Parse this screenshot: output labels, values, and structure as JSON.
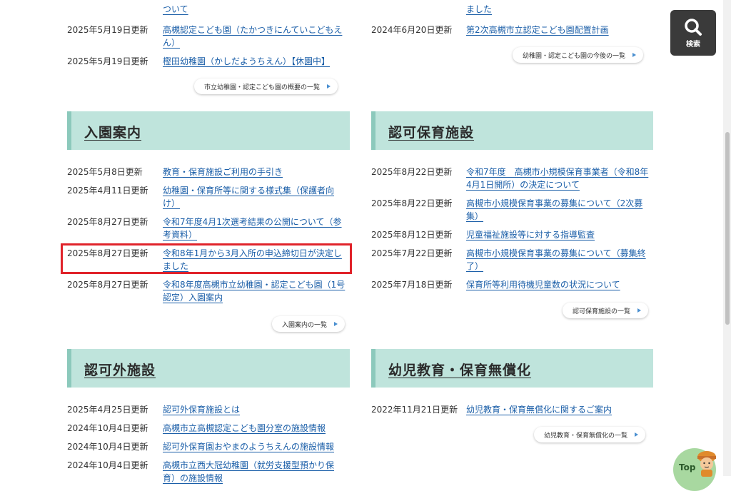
{
  "top_left": {
    "partial_row": {
      "link_tail": "ついて"
    },
    "rows": [
      {
        "date": "2025年5月19日更新",
        "link": [
          "高槻認定こども園（たかつきにんていこどもえ",
          "ん）"
        ]
      },
      {
        "date": "2025年5月19日更新",
        "link": [
          "樫田幼稚園（かしだようちえん）【休園中】"
        ]
      }
    ],
    "more": "市立幼稚園・認定こども園の概要の一覧"
  },
  "top_right": {
    "partial_row": {
      "link_tail": "ました"
    },
    "rows": [
      {
        "date": "2024年6月20日更新",
        "link": [
          "第2次高槻市立認定こども園配置計画"
        ]
      }
    ],
    "more": "幼稚園・認定こども園の今後の一覧"
  },
  "admission": {
    "title": "入園案内",
    "rows": [
      {
        "date": "2025年5月8日更新",
        "link": [
          "教育・保育施設ご利用の手引き"
        ]
      },
      {
        "date": "2025年4月11日更新",
        "link": [
          "幼稚園・保育所等に関する様式集（保護者向",
          "け）"
        ]
      },
      {
        "date": "2025年8月27日更新",
        "link": [
          "令和7年度4月1次選考結果の公開について（参",
          "考資料）"
        ]
      },
      {
        "date": "2025年8月27日更新",
        "link": [
          "令和8年1月から3月入所の申込締切日が決定し",
          "ました"
        ]
      },
      {
        "date": "2025年8月27日更新",
        "link": [
          "令和8年度高槻市立幼稚園・認定こども園（1号",
          "認定）入園案内"
        ]
      }
    ],
    "more": "入園案内の一覧"
  },
  "licensed": {
    "title": "認可保育施設",
    "rows": [
      {
        "date": "2025年8月22日更新",
        "link": [
          "令和7年度　高槻市小規模保育事業者（令和8年",
          "4月1日開所）の決定について"
        ]
      },
      {
        "date": "2025年8月22日更新",
        "link": [
          "高槻市小規模保育事業の募集について（2次募",
          "集）"
        ]
      },
      {
        "date": "2025年8月12日更新",
        "link": [
          "児童福祉施設等に対する指導監査"
        ]
      },
      {
        "date": "2025年7月22日更新",
        "link": [
          "高槻市小規模保育事業の募集について（募集終",
          "了）"
        ]
      },
      {
        "date": "2025年7月18日更新",
        "link": [
          "保育所等利用待機児童数の状況について"
        ]
      }
    ],
    "more": "認可保育施設の一覧"
  },
  "unlicensed": {
    "title": "認可外施設",
    "rows": [
      {
        "date": "2025年4月25日更新",
        "link": [
          "認可外保育施設とは"
        ]
      },
      {
        "date": "2024年10月4日更新",
        "link": [
          "高槻市立高槻認定こども園分室の施設情報"
        ]
      },
      {
        "date": "2024年10月4日更新",
        "link": [
          "認可外保育園おやまのようちえんの施設情報"
        ]
      },
      {
        "date": "2024年10月4日更新",
        "link": [
          "高槻市立西大冠幼稚園（就労支援型預かり保",
          "育）の施設情報"
        ]
      }
    ]
  },
  "free_edu": {
    "title": "幼児教育・保育無償化",
    "rows": [
      {
        "date": "2022年11月21日更新",
        "link": [
          "幼児教育・保育無償化に関するご案内"
        ]
      }
    ],
    "more": "幼児教育・保育無償化の一覧"
  },
  "search": {
    "label": "検索"
  },
  "top_button": {
    "label": "Top"
  },
  "colors": {
    "heading_bg": "#bfe4dc",
    "link": "#1a5ea8",
    "highlight": "#e0232a"
  }
}
